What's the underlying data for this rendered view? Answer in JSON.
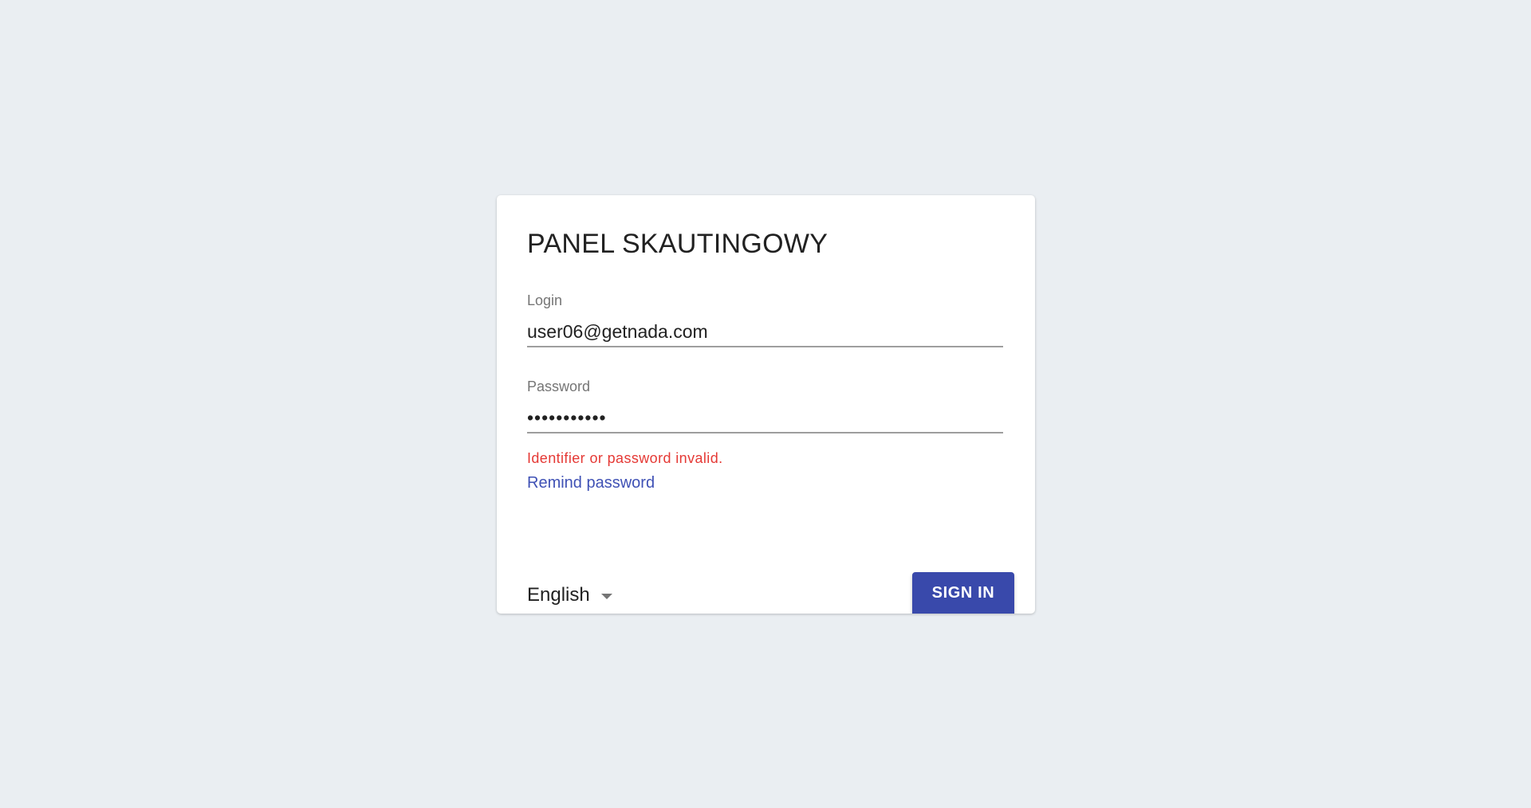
{
  "card": {
    "title": "PANEL SKAUTINGOWY"
  },
  "login": {
    "label": "Login",
    "value": "user06@getnada.com"
  },
  "password": {
    "label": "Password",
    "value": "•••••••••••"
  },
  "error": {
    "message": "Identifier or password invalid."
  },
  "links": {
    "remind": "Remind password"
  },
  "language": {
    "selected": "English"
  },
  "actions": {
    "sign_in": "SIGN IN"
  },
  "colors": {
    "background": "#eaeef2",
    "primary": "#3949ab",
    "link": "#3f51b5",
    "error": "#e53935"
  }
}
